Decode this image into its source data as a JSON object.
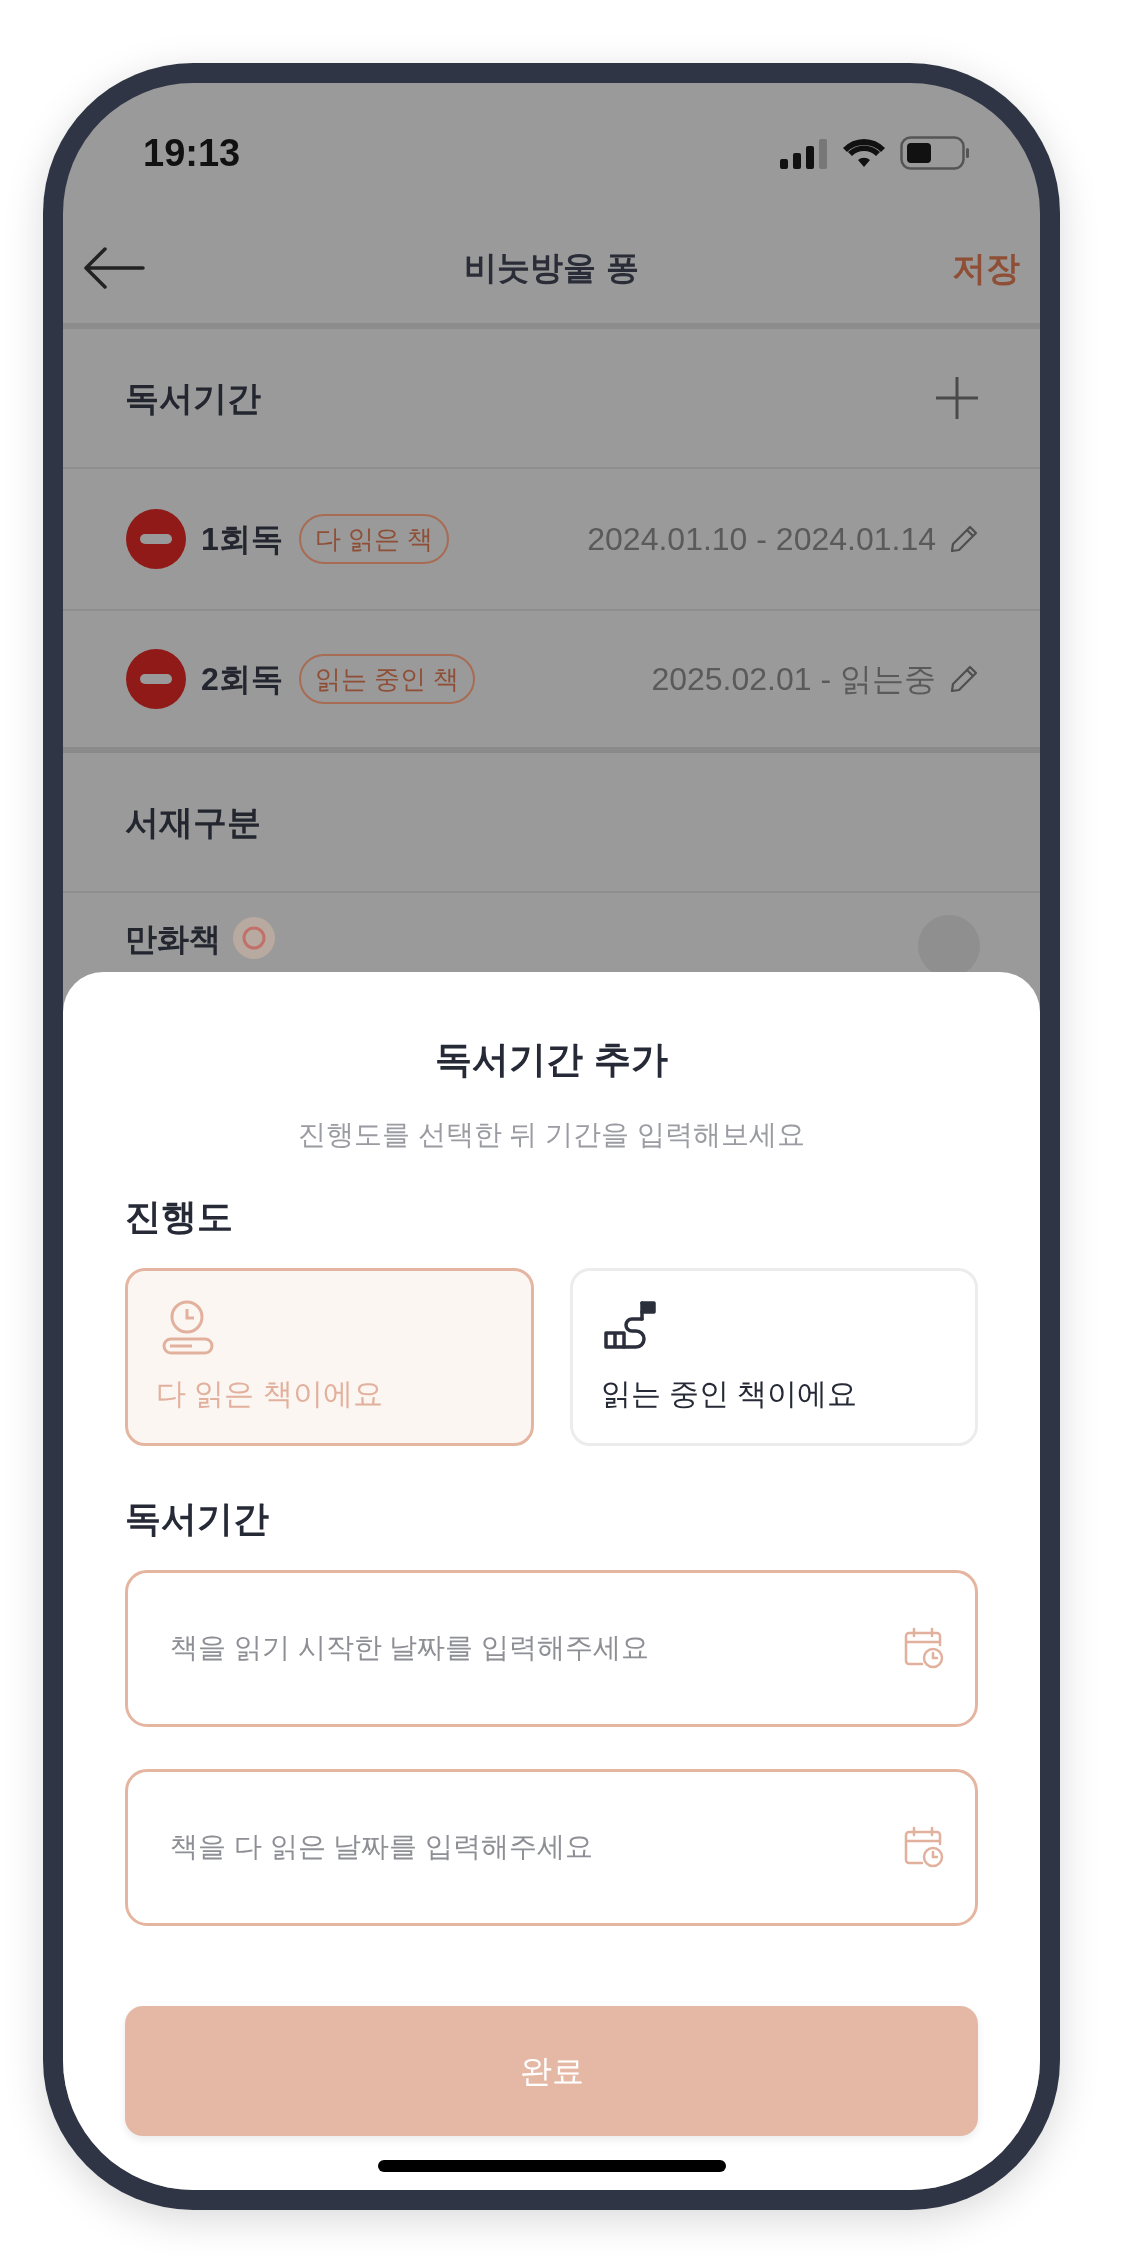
{
  "status_bar": {
    "time": "19:13"
  },
  "nav": {
    "title": "비눗방울 퐁",
    "action": "저장"
  },
  "reading_periods": {
    "title": "독서기간",
    "entries": [
      {
        "round": "1회독",
        "tag": "다 읽은 책",
        "dates": "2024.01.10 - 2024.01.14"
      },
      {
        "round": "2회독",
        "tag": "읽는 중인 책",
        "dates": "2025.02.01 - 읽는중"
      }
    ]
  },
  "shelf": {
    "title": "서재구분",
    "items": [
      {
        "label": "만화책"
      }
    ]
  },
  "sheet": {
    "title": "독서기간 추가",
    "subtitle": "진행도를 선택한 뒤 기간을 입력해보세요",
    "progress_label": "진행도",
    "options": [
      {
        "kind": "finished",
        "label": "다 읽은 책이에요",
        "selected": true
      },
      {
        "kind": "reading",
        "label": "읽는 중인 책이에요",
        "selected": false
      }
    ],
    "period_label": "독서기간",
    "fields": [
      {
        "placeholder": "책을 읽기 시작한 날짜를 입력해주세요"
      },
      {
        "placeholder": "책을 다 읽은 날짜를 입력해주세요"
      }
    ],
    "button": "완료"
  }
}
